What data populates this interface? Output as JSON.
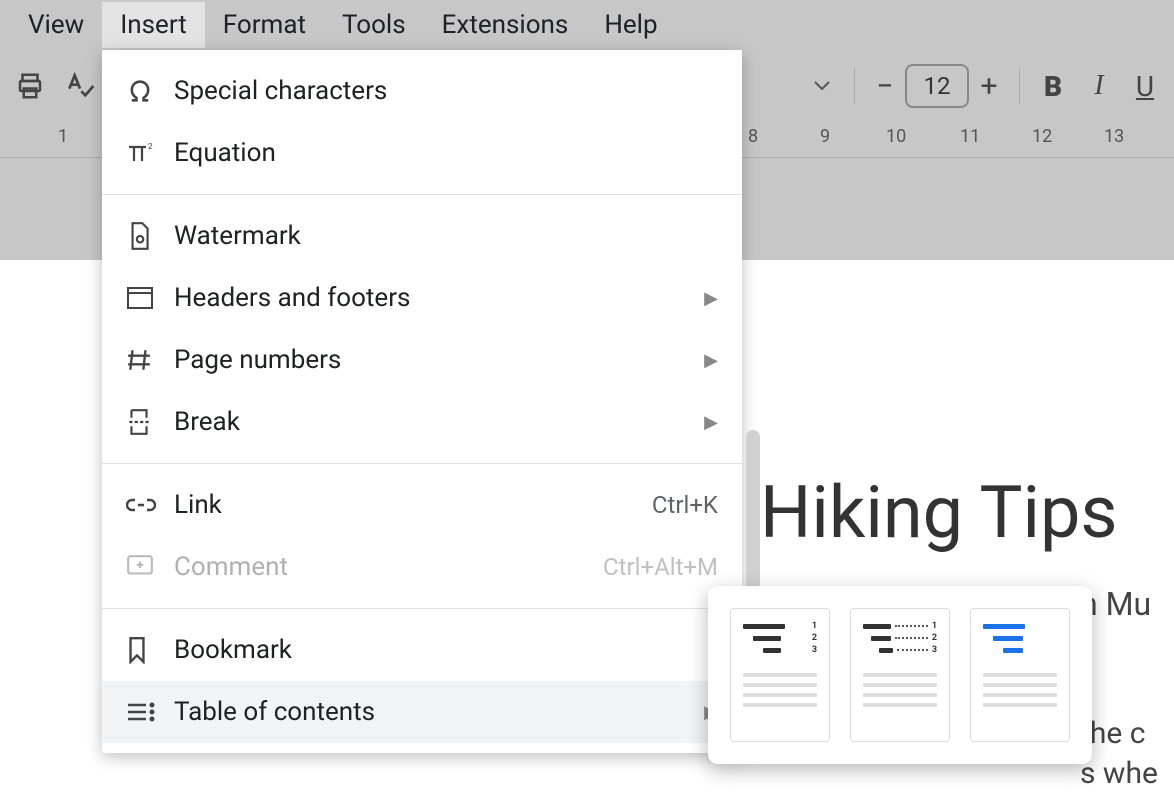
{
  "menubar": {
    "items": [
      "View",
      "Insert",
      "Format",
      "Tools",
      "Extensions",
      "Help"
    ],
    "activeIndex": 1
  },
  "toolbar": {
    "fontSize": "12"
  },
  "ruler": {
    "visibleNumbers": [
      "1",
      "8",
      "9",
      "10",
      "11",
      "12",
      "13"
    ]
  },
  "insertMenu": {
    "items": [
      {
        "icon": "omega",
        "label": "Special characters"
      },
      {
        "icon": "pi",
        "label": "Equation"
      },
      {
        "divider": true
      },
      {
        "icon": "watermark",
        "label": "Watermark"
      },
      {
        "icon": "header-footer",
        "label": "Headers and footers",
        "hasSubmenu": true
      },
      {
        "icon": "hash",
        "label": "Page numbers",
        "hasSubmenu": true
      },
      {
        "icon": "break",
        "label": "Break",
        "hasSubmenu": true
      },
      {
        "divider": true
      },
      {
        "icon": "link",
        "label": "Link",
        "shortcut": "Ctrl+K"
      },
      {
        "icon": "comment",
        "label": "Comment",
        "shortcut": "Ctrl+Alt+M",
        "disabled": true
      },
      {
        "divider": true
      },
      {
        "icon": "bookmark",
        "label": "Bookmark"
      },
      {
        "icon": "toc",
        "label": "Table of contents",
        "hasSubmenu": true,
        "hover": true
      }
    ]
  },
  "tocSubmenu": {
    "options": [
      "plain-numbers",
      "dotted-numbers",
      "blue-links"
    ]
  },
  "document": {
    "titleFragment": "Hiking Tips",
    "subFragment": "n Mu",
    "bodyFragment1": "the  c",
    "bodyFragment2": "s whe"
  }
}
